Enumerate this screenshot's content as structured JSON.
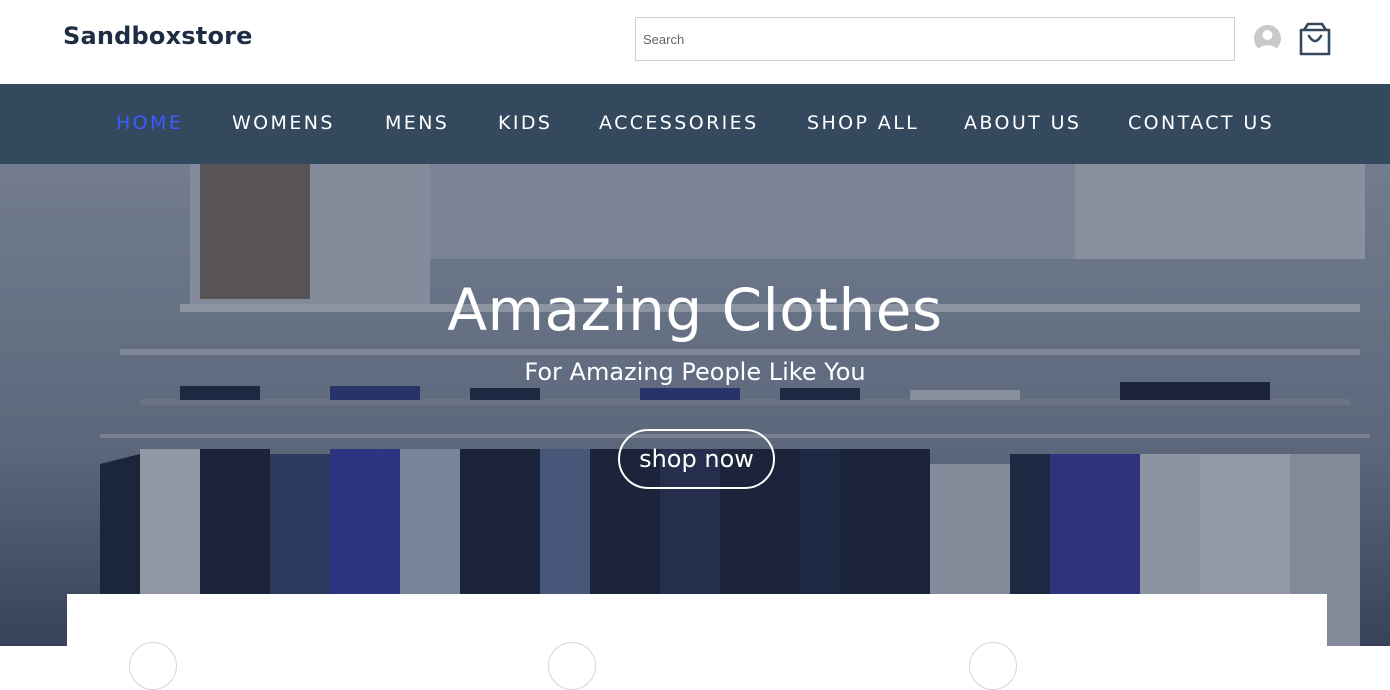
{
  "header": {
    "logo": "Sandboxstore",
    "search_placeholder": "Search",
    "avatar_icon": "user-avatar-icon",
    "cart_icon": "shopping-bag-icon"
  },
  "nav": {
    "items": [
      {
        "label": "HOME",
        "active": true
      },
      {
        "label": "WOMENS",
        "active": false
      },
      {
        "label": "MENS",
        "active": false
      },
      {
        "label": "KIDS",
        "active": false
      },
      {
        "label": "ACCESSORIES",
        "active": false
      },
      {
        "label": "SHOP ALL",
        "active": false
      },
      {
        "label": "ABOUT US",
        "active": false
      },
      {
        "label": "CONTACT US",
        "active": false
      }
    ]
  },
  "hero": {
    "title": "Amazing Clothes",
    "subtitle": "For Amazing People Like You",
    "button_label": "shop now",
    "background": "clothing-store-interior-photo"
  },
  "colors": {
    "nav_bg": "#34495e",
    "active_link": "#3a5bff",
    "logo": "#1f2d44"
  }
}
